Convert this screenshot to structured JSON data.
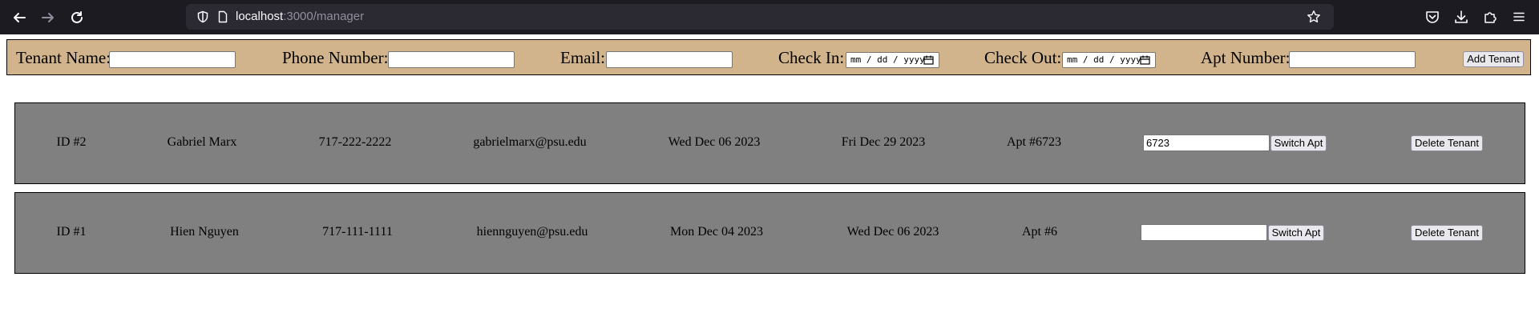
{
  "browser": {
    "url_host": "localhost",
    "url_path": ":3000/manager"
  },
  "form": {
    "tenant_name_label": "Tenant Name:",
    "phone_label": "Phone Number:",
    "email_label": "Email:",
    "checkin_label": "Check In:",
    "checkin_placeholder": "mm / dd / yyyy",
    "checkout_label": "Check Out:",
    "checkout_placeholder": "mm / dd / yyyy",
    "apt_label": "Apt Number:",
    "add_button": "Add Tenant"
  },
  "tenants": [
    {
      "id": "ID #2",
      "name": "Gabriel Marx",
      "phone": "717-222-2222",
      "email": "gabrielmarx@psu.edu",
      "check_in": "Wed Dec 06 2023",
      "check_out": "Fri Dec 29 2023",
      "apt": "Apt #6723",
      "switch_value": "6723",
      "switch_button": "Switch Apt",
      "delete_button": "Delete Tenant"
    },
    {
      "id": "ID #1",
      "name": "Hien Nguyen",
      "phone": "717-111-1111",
      "email": "hiennguyen@psu.edu",
      "check_in": "Mon Dec 04 2023",
      "check_out": "Wed Dec 06 2023",
      "apt": "Apt #6",
      "switch_value": "",
      "switch_button": "Switch Apt",
      "delete_button": "Delete Tenant"
    }
  ]
}
